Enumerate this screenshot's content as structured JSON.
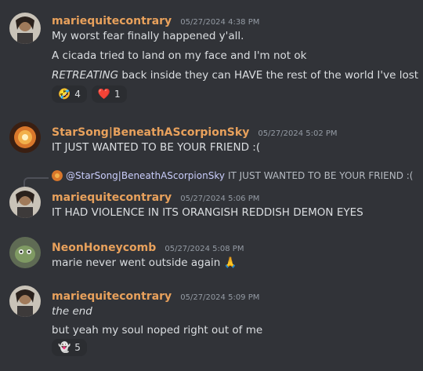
{
  "messages": [
    {
      "username": "mariequitecontrary",
      "timestamp": "05/27/2024 4:38 PM",
      "lines": [
        "My worst fear finally happened y'all.",
        "A cicada tried to land on my face and I'm not ok"
      ],
      "line3_italic": "RETREATING",
      "line3_rest": " back inside they can HAVE the rest of the world I've lost",
      "reactions": [
        {
          "emoji": "🤣",
          "count": "4"
        },
        {
          "emoji": "❤️",
          "count": "1"
        }
      ]
    },
    {
      "username": "StarSong|BeneathAScorpionSky",
      "timestamp": "05/27/2024 5:02 PM",
      "lines": [
        "IT JUST WANTED TO BE YOUR FRIEND :("
      ]
    },
    {
      "reply": {
        "mention": "@StarSong|BeneathAScorpionSky",
        "text": "IT JUST WANTED TO BE YOUR FRIEND :("
      },
      "username": "mariequitecontrary",
      "timestamp": "05/27/2024 5:06 PM",
      "lines": [
        "IT HAD VIOLENCE IN ITS ORANGISH REDDISH DEMON EYES"
      ]
    },
    {
      "username": "NeonHoneycomb",
      "timestamp": "05/27/2024 5:08 PM",
      "lines": [
        "marie never went outside again"
      ],
      "inline_emoji": "🙏"
    },
    {
      "username": "mariequitecontrary",
      "timestamp": "05/27/2024 5:09 PM",
      "line1_italic": "the end",
      "lines": [
        "but yeah my soul noped right out of me"
      ],
      "reactions": [
        {
          "emoji": "👻",
          "count": "5"
        }
      ]
    }
  ],
  "colors": {
    "background": "#313338",
    "username": "#e8a15c",
    "timestamp": "#949ba4",
    "text": "#dbdee1",
    "reaction_bg": "#2b2d31",
    "mention": "#c9cdfb"
  }
}
